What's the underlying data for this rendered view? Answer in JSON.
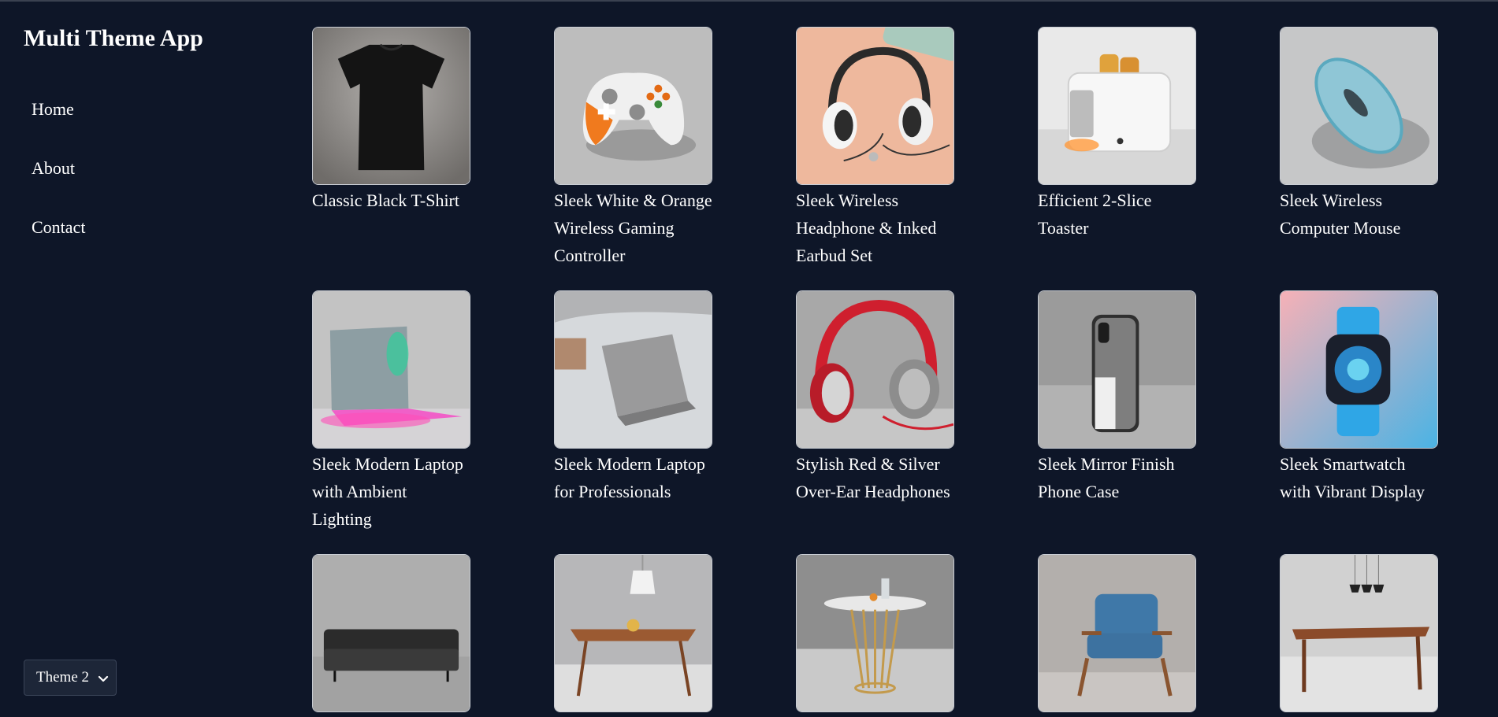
{
  "app": {
    "title": "Multi Theme App"
  },
  "nav": {
    "items": [
      {
        "label": "Home"
      },
      {
        "label": "About"
      },
      {
        "label": "Contact"
      }
    ]
  },
  "theme": {
    "selected": "Theme 2",
    "options": [
      "Theme 2"
    ]
  },
  "products": [
    {
      "name": "Classic Black T-Shirt",
      "image": "black-tshirt"
    },
    {
      "name": "Sleek White & Orange Wireless Gaming Controller",
      "image": "game-controller"
    },
    {
      "name": "Sleek Wireless Headphone & Inked Earbud Set",
      "image": "headphones-earbuds"
    },
    {
      "name": "Efficient 2-Slice Toaster",
      "image": "toaster"
    },
    {
      "name": "Sleek Wireless Computer Mouse",
      "image": "computer-mouse"
    },
    {
      "name": "Sleek Modern Laptop with Ambient Lighting",
      "image": "laptop-ambient"
    },
    {
      "name": "Sleek Modern Laptop for Professionals",
      "image": "laptop-pro"
    },
    {
      "name": "Stylish Red & Silver Over-Ear Headphones",
      "image": "red-headphones"
    },
    {
      "name": "Sleek Mirror Finish Phone Case",
      "image": "phone-case"
    },
    {
      "name": "Sleek Smartwatch with Vibrant Display",
      "image": "smartwatch"
    },
    {
      "name": "",
      "image": "leather-sofa"
    },
    {
      "name": "",
      "image": "dining-table-lamp"
    },
    {
      "name": "",
      "image": "round-table"
    },
    {
      "name": "",
      "image": "blue-armchair"
    },
    {
      "name": "",
      "image": "long-table"
    }
  ]
}
